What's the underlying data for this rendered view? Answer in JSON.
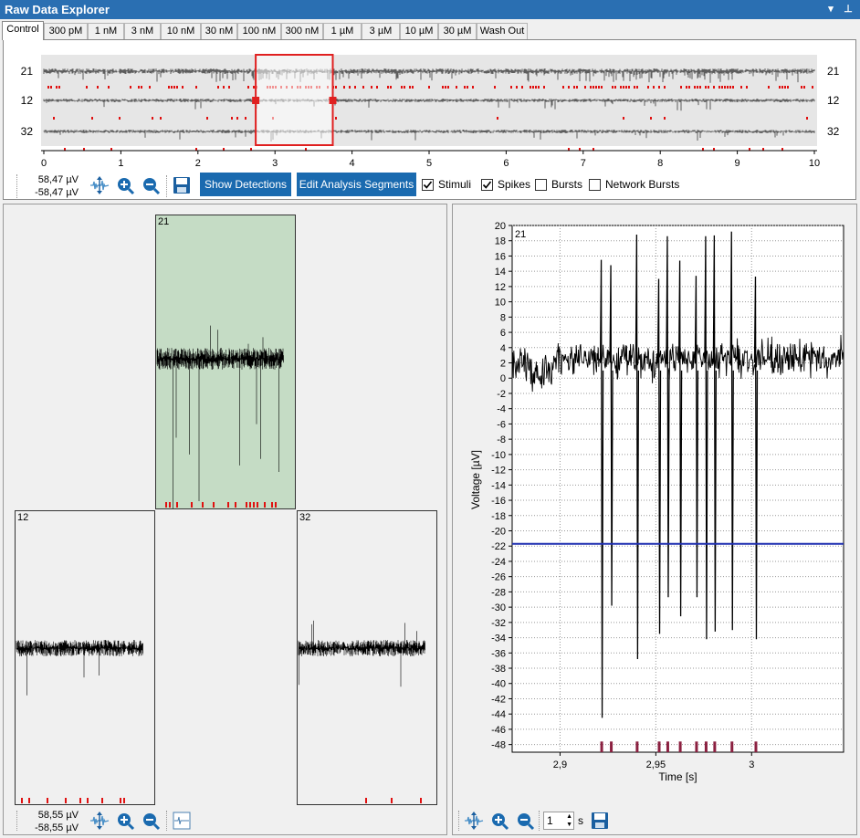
{
  "window": {
    "title": "Raw Data Explorer",
    "menu_glyph": "▾",
    "pin_glyph": "⊥"
  },
  "tabs": [
    "Control",
    "300 pM",
    "1 nM",
    "3 nM",
    "10 nM",
    "30 nM",
    "100 nM",
    "300 nM",
    "1 µM",
    "3 µM",
    "10 µM",
    "30 µM",
    "Wash Out"
  ],
  "active_tab": 0,
  "overview": {
    "channels": [
      "21",
      "12",
      "32"
    ],
    "x_ticks": [
      "0",
      "1",
      "2",
      "3",
      "4",
      "5",
      "6",
      "7",
      "8",
      "9",
      "10"
    ],
    "selection_start_s": 2.75,
    "selection_end_s": 3.75,
    "toolbar": {
      "range_max": "58,47 µV",
      "range_min": "-58,47 µV",
      "show_detections_label": "Show Detections",
      "edit_segments_label": "Edit Analysis Segments",
      "checkboxes": [
        {
          "label": "Stimuli",
          "checked": true
        },
        {
          "label": "Spikes",
          "checked": true
        },
        {
          "label": "Bursts",
          "checked": false
        },
        {
          "label": "Network Bursts",
          "checked": false
        }
      ]
    }
  },
  "left_panel": {
    "channels": [
      "21",
      "12",
      "32"
    ],
    "selected_channel": "21",
    "range_max": "58,55 µV",
    "range_min": "-58,55 µV"
  },
  "right_panel": {
    "channel_label": "21",
    "spin_value": "1",
    "spin_unit": "s",
    "threshold_color": "#1f2fb0",
    "spike_marker_color": "#8b2040"
  },
  "chart_data": {
    "type": "line",
    "title": "",
    "xlabel": "Time [s]",
    "ylabel": "Voltage [µV]",
    "xlim": [
      2.875,
      3.048
    ],
    "ylim": [
      -49,
      20
    ],
    "x_ticks": [
      "2,9",
      "2,95",
      "3"
    ],
    "x_tick_values": [
      2.9,
      2.95,
      3.0
    ],
    "y_ticks": [
      "20",
      "18",
      "16",
      "14",
      "12",
      "10",
      "8",
      "6",
      "4",
      "2",
      "0",
      "-2",
      "-4",
      "-6",
      "-8",
      "-10",
      "-12",
      "-14",
      "-16",
      "-18",
      "-20",
      "-22",
      "-24",
      "-26",
      "-28",
      "-30",
      "-32",
      "-34",
      "-36",
      "-38",
      "-40",
      "-42",
      "-44",
      "-46",
      "-48"
    ],
    "threshold_uV": -21.7,
    "grid": true,
    "spike_times": [
      2.9215,
      2.9265,
      2.94,
      2.9515,
      2.956,
      2.9625,
      2.971,
      2.976,
      2.9805,
      2.9895,
      3.002
    ],
    "spike_min_uV": [
      -44.5,
      -29.8,
      -36.8,
      -33.5,
      -28.7,
      -31.2,
      -28.7,
      -34.2,
      -33.2,
      -33.0,
      -34.2
    ],
    "spike_max_uV": [
      15.5,
      14.8,
      18.8,
      13.0,
      18.6,
      15.4,
      13.4,
      18.6,
      18.7,
      19.2,
      13.3
    ]
  }
}
